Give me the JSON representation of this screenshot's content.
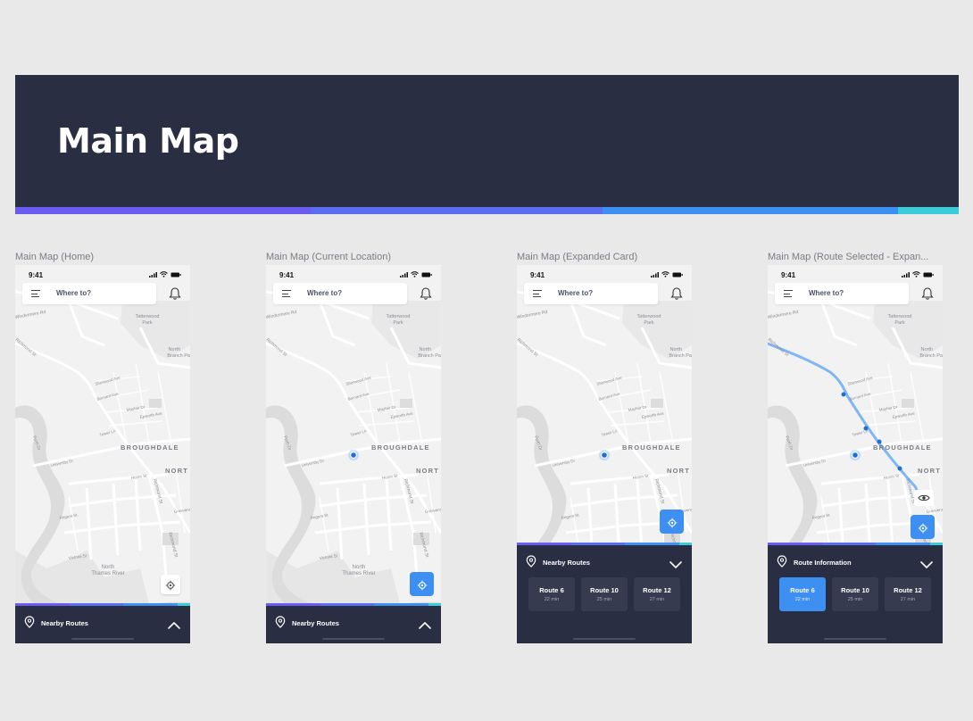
{
  "banner": {
    "title": "Main Map"
  },
  "colors": {
    "banner_bg": "#2a2e43",
    "accent_blue": "#3d8ff2",
    "gradient": [
      "#6a5cf0",
      "#5b6ef2",
      "#3d8ff2",
      "#3ccbd8"
    ],
    "sheet_bg": "#2a2e43",
    "card_bg": "#373b50",
    "route_line": "#7fb6f4"
  },
  "frames": [
    {
      "label": "Main Map (Home)",
      "status_time": "9:41",
      "search_placeholder": "Where to?",
      "sheet": {
        "state": "collapsed",
        "title": "Nearby Routes"
      },
      "locate_button": "white"
    },
    {
      "label": "Main Map (Current Location)",
      "status_time": "9:41",
      "search_placeholder": "Where to?",
      "sheet": {
        "state": "collapsed",
        "title": "Nearby Routes"
      },
      "locate_button": "blue"
    },
    {
      "label": "Main Map (Expanded Card)",
      "status_time": "9:41",
      "search_placeholder": "Where to?",
      "sheet": {
        "state": "expanded",
        "title": "Nearby Routes",
        "routes": [
          {
            "name": "Route 6",
            "time": "22 min"
          },
          {
            "name": "Route 10",
            "time": "25 min"
          },
          {
            "name": "Route 12",
            "time": "27 min"
          }
        ]
      },
      "locate_button": "blue"
    },
    {
      "label": "Main Map (Route Selected - Expan...",
      "status_time": "9:41",
      "search_placeholder": "Where to?",
      "sheet": {
        "state": "expanded",
        "title": "Route Information",
        "routes": [
          {
            "name": "Route 6",
            "time": "22 min",
            "selected": true
          },
          {
            "name": "Route 10",
            "time": "25 min"
          },
          {
            "name": "Route 12",
            "time": "27 min"
          }
        ]
      },
      "locate_button": "blue"
    }
  ],
  "map_labels": {
    "park": "Tatterwood Park",
    "park_l1": "Tatterwood",
    "park_l2": "Park",
    "branch_l1": "North",
    "branch_l2": "Branch Pa",
    "district1": "BROUGHDALE",
    "district2": "NORT",
    "river_l1": "North",
    "river_l2": "Thames River",
    "streets": {
      "richmond_nw": "Richmond St",
      "windermere": "Windermere Rd",
      "richmond_s": "Richmond St",
      "richmond_s2": "Richmond St",
      "university": "University Dr",
      "perth": "Perth Dr",
      "sherwood": "Sherwood Ave",
      "epworth": "Epworth Ave",
      "mayfair": "Mayfair Dr",
      "bernard": "Bernard Ave",
      "regent": "Regent St",
      "victoria": "Victoria St",
      "huron": "Huron St",
      "grosvenor": "Grosvenor St",
      "tower": "Tower Ln",
      "rich2": "Richmond St"
    },
    "icons": {
      "menu": "menu-icon",
      "bell": "bell-icon",
      "locate": "locate-icon",
      "pin": "location-pin-icon",
      "chevron_up": "chevron-up-icon",
      "chevron_down": "chevron-down-icon",
      "eye": "eye-icon"
    }
  }
}
